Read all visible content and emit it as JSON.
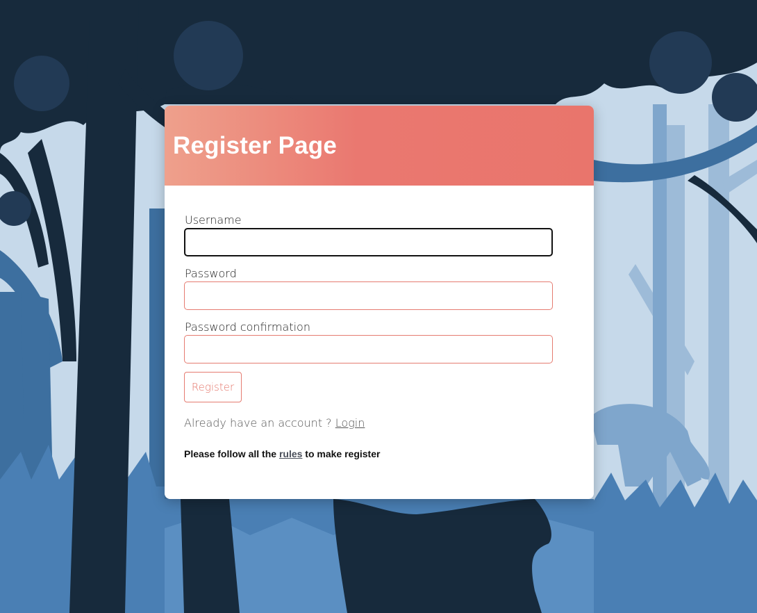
{
  "page": {
    "title": "Register Page"
  },
  "form": {
    "username_label": "Username",
    "username_value": "",
    "password_label": "Password",
    "password_value": "",
    "password_confirmation_label": "Password confirmation",
    "password_confirmation_value": "",
    "register_label": "Register"
  },
  "footer": {
    "account_prompt": "Already have an account ?",
    "login_link": "Login",
    "rules_prefix": "Please follow all the",
    "rules_link": "rules",
    "rules_suffix": "to make register"
  },
  "colors": {
    "accent": "#e9756c",
    "forest_dark": "#172a3c",
    "forest_mid": "#3a6e9e",
    "sky": "#c9dcec"
  },
  "icons": {
    "background": "forest-with-panther-illustration"
  }
}
